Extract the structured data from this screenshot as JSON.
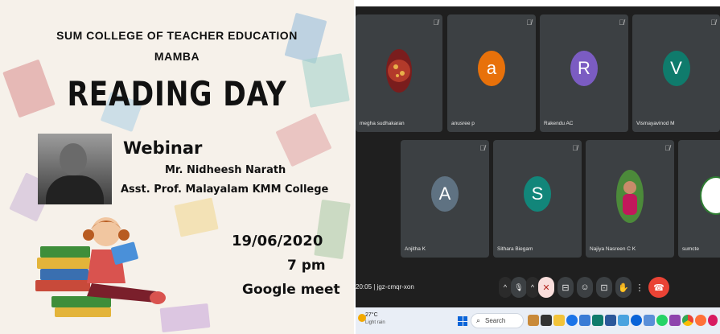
{
  "poster": {
    "org_line1": "SUM COLLEGE OF TEACHER EDUCATION",
    "org_line2": "MAMBA",
    "title": "READING DAY",
    "event_type": "Webinar",
    "speaker": "Mr. Nidheesh Narath",
    "designation": "Asst. Prof. Malayalam KMM College",
    "date": "19/06/2020",
    "time": "7 pm",
    "platform": "Google meet"
  },
  "meet": {
    "participants_row1": [
      {
        "name": "megha sudhakaran",
        "type": "photo",
        "color": "#7a1d1d"
      },
      {
        "name": "anusree p",
        "initial": "a",
        "color": "#e8710a"
      },
      {
        "name": "Rakendu AC",
        "initial": "R",
        "color": "#7b5cc2"
      },
      {
        "name": "Vismayavinod M",
        "initial": "V",
        "color": "#0f7b6c"
      }
    ],
    "participants_row2": [
      {
        "name": "Anjitha K",
        "initial": "A",
        "color": "#5f7282"
      },
      {
        "name": "Sithara Biegam",
        "initial": "S",
        "color": "#12867a"
      },
      {
        "name": "Najiya Nasreen C K",
        "type": "photo",
        "color": "#4c8a3a"
      },
      {
        "name": "sumcte",
        "type": "logo",
        "color": "#ffffff"
      }
    ],
    "meeting_time": "20:05",
    "meeting_code": "jgz-cmqr-xon",
    "controls": [
      {
        "name": "more-audio-options",
        "icon": "^"
      },
      {
        "name": "microphone",
        "icon": "🎙"
      },
      {
        "name": "more-video-options",
        "icon": "^"
      },
      {
        "name": "camera-off",
        "icon": "✕"
      },
      {
        "name": "captions",
        "icon": "⊟"
      },
      {
        "name": "emoji",
        "icon": "☺"
      },
      {
        "name": "present-screen",
        "icon": "⊡"
      },
      {
        "name": "raise-hand",
        "icon": "✋"
      },
      {
        "name": "more-options",
        "icon": "⋮"
      },
      {
        "name": "leave-call",
        "icon": "☎"
      }
    ]
  },
  "taskbar": {
    "temperature": "27°C",
    "weather": "Light rain",
    "search_label": "Search",
    "colors": {
      "accent": "#0a64d8",
      "leave": "#ea4335"
    }
  }
}
